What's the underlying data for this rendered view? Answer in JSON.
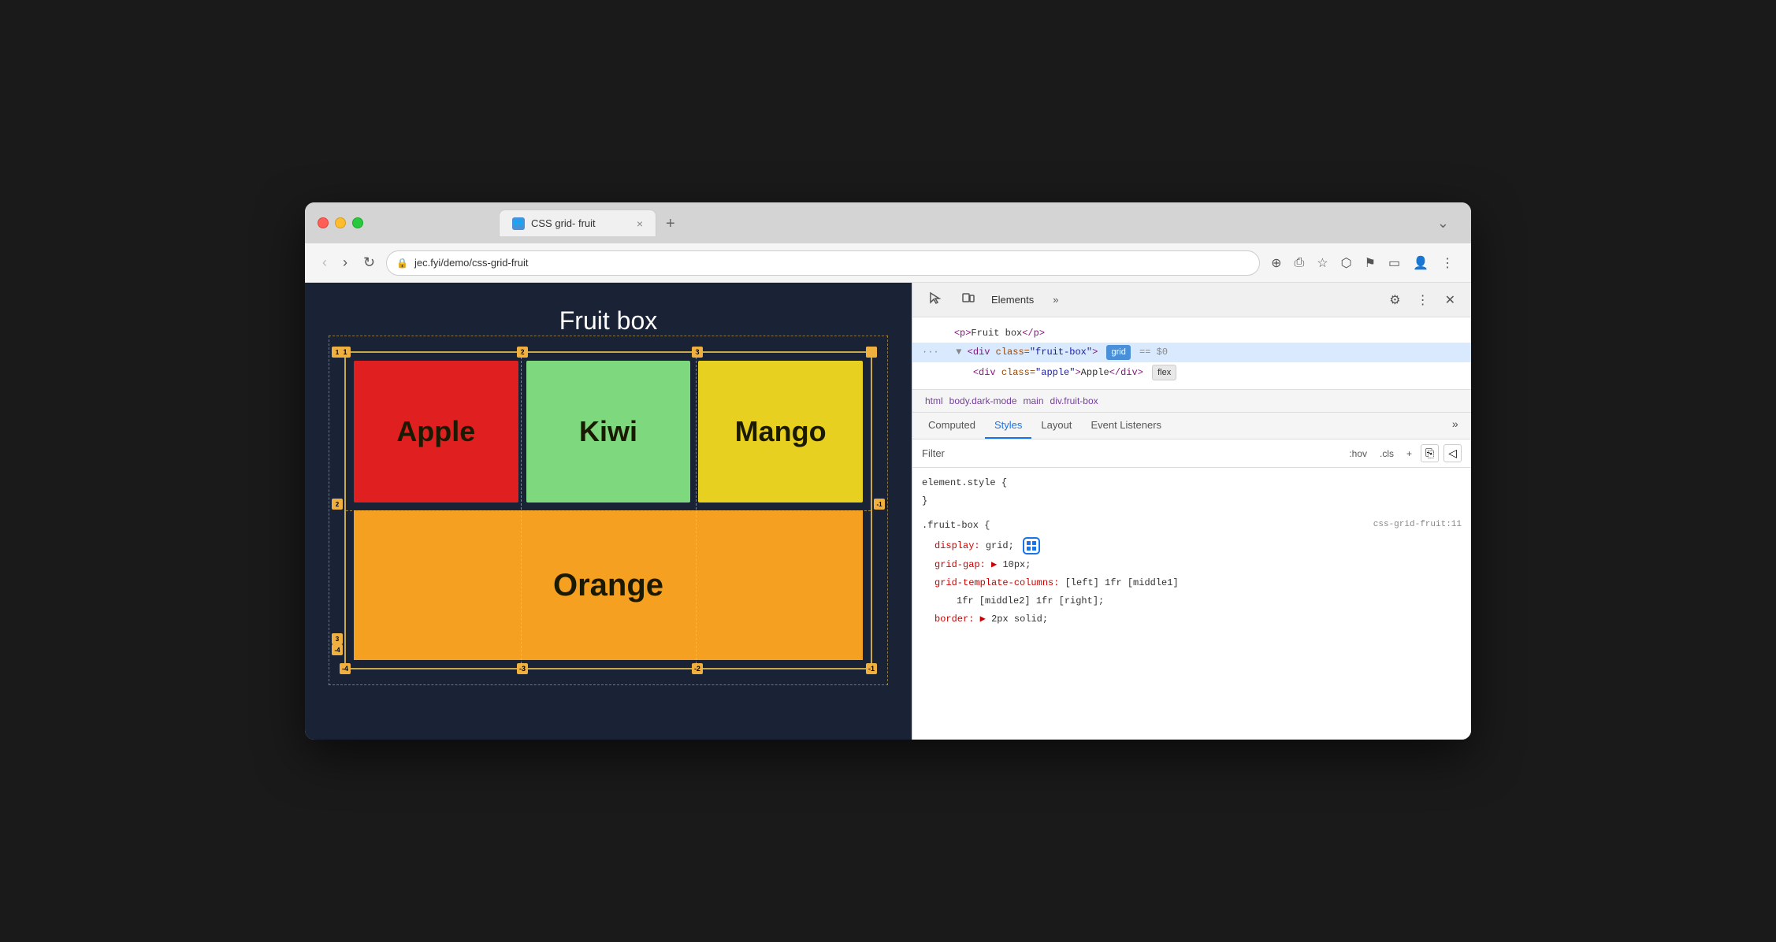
{
  "window": {
    "title": "CSS grid- fruit",
    "url": "jec.fyi/demo/css-grid-fruit"
  },
  "tabs": [
    {
      "label": "CSS grid- fruit",
      "active": true,
      "favicon": "🔒"
    }
  ],
  "webpage": {
    "title": "Fruit box",
    "fruits": [
      {
        "name": "Apple",
        "color": "#e02020"
      },
      {
        "name": "Kiwi",
        "color": "#7ed87e"
      },
      {
        "name": "Mango",
        "color": "#e8d020"
      },
      {
        "name": "Orange",
        "color": "#f5a020"
      }
    ]
  },
  "devtools": {
    "main_tabs": [
      "Elements",
      ""
    ],
    "dom": {
      "line1": "<p>Fruit box</p>",
      "line2_pre": "<div class=\"fruit-box\">",
      "line2_badge": "grid",
      "line2_eq": "==",
      "line2_dollar": "$0",
      "line3_pre": "<div class=\"apple\">Apple</div>",
      "line3_badge": "flex"
    },
    "breadcrumb": [
      "html",
      "body.dark-mode",
      "main",
      "div.fruit-box"
    ],
    "sub_tabs": [
      "Computed",
      "Styles",
      "Layout",
      "Event Listeners",
      "»"
    ],
    "active_sub_tab": "Styles",
    "filter_placeholder": "Filter",
    "filter_btns": [
      ":hov",
      ".cls",
      "+",
      ""
    ],
    "css_rules": [
      {
        "selector": "element.style {",
        "close": "}",
        "props": []
      },
      {
        "selector": ".fruit-box {",
        "source": "css-grid-fruit:11",
        "props": [
          {
            "name": "display:",
            "value": "grid;",
            "has_icon": true
          },
          {
            "name": "grid-gap:",
            "value": "▶ 10px;",
            "triangle": true
          },
          {
            "name": "grid-template-columns:",
            "value": "[left] 1fr [middle1]"
          },
          {
            "name": "",
            "value": "1fr [middle2] 1fr [right];"
          },
          {
            "name": "border:",
            "value": "▶ 2px solid;",
            "triangle": true
          }
        ]
      }
    ]
  }
}
